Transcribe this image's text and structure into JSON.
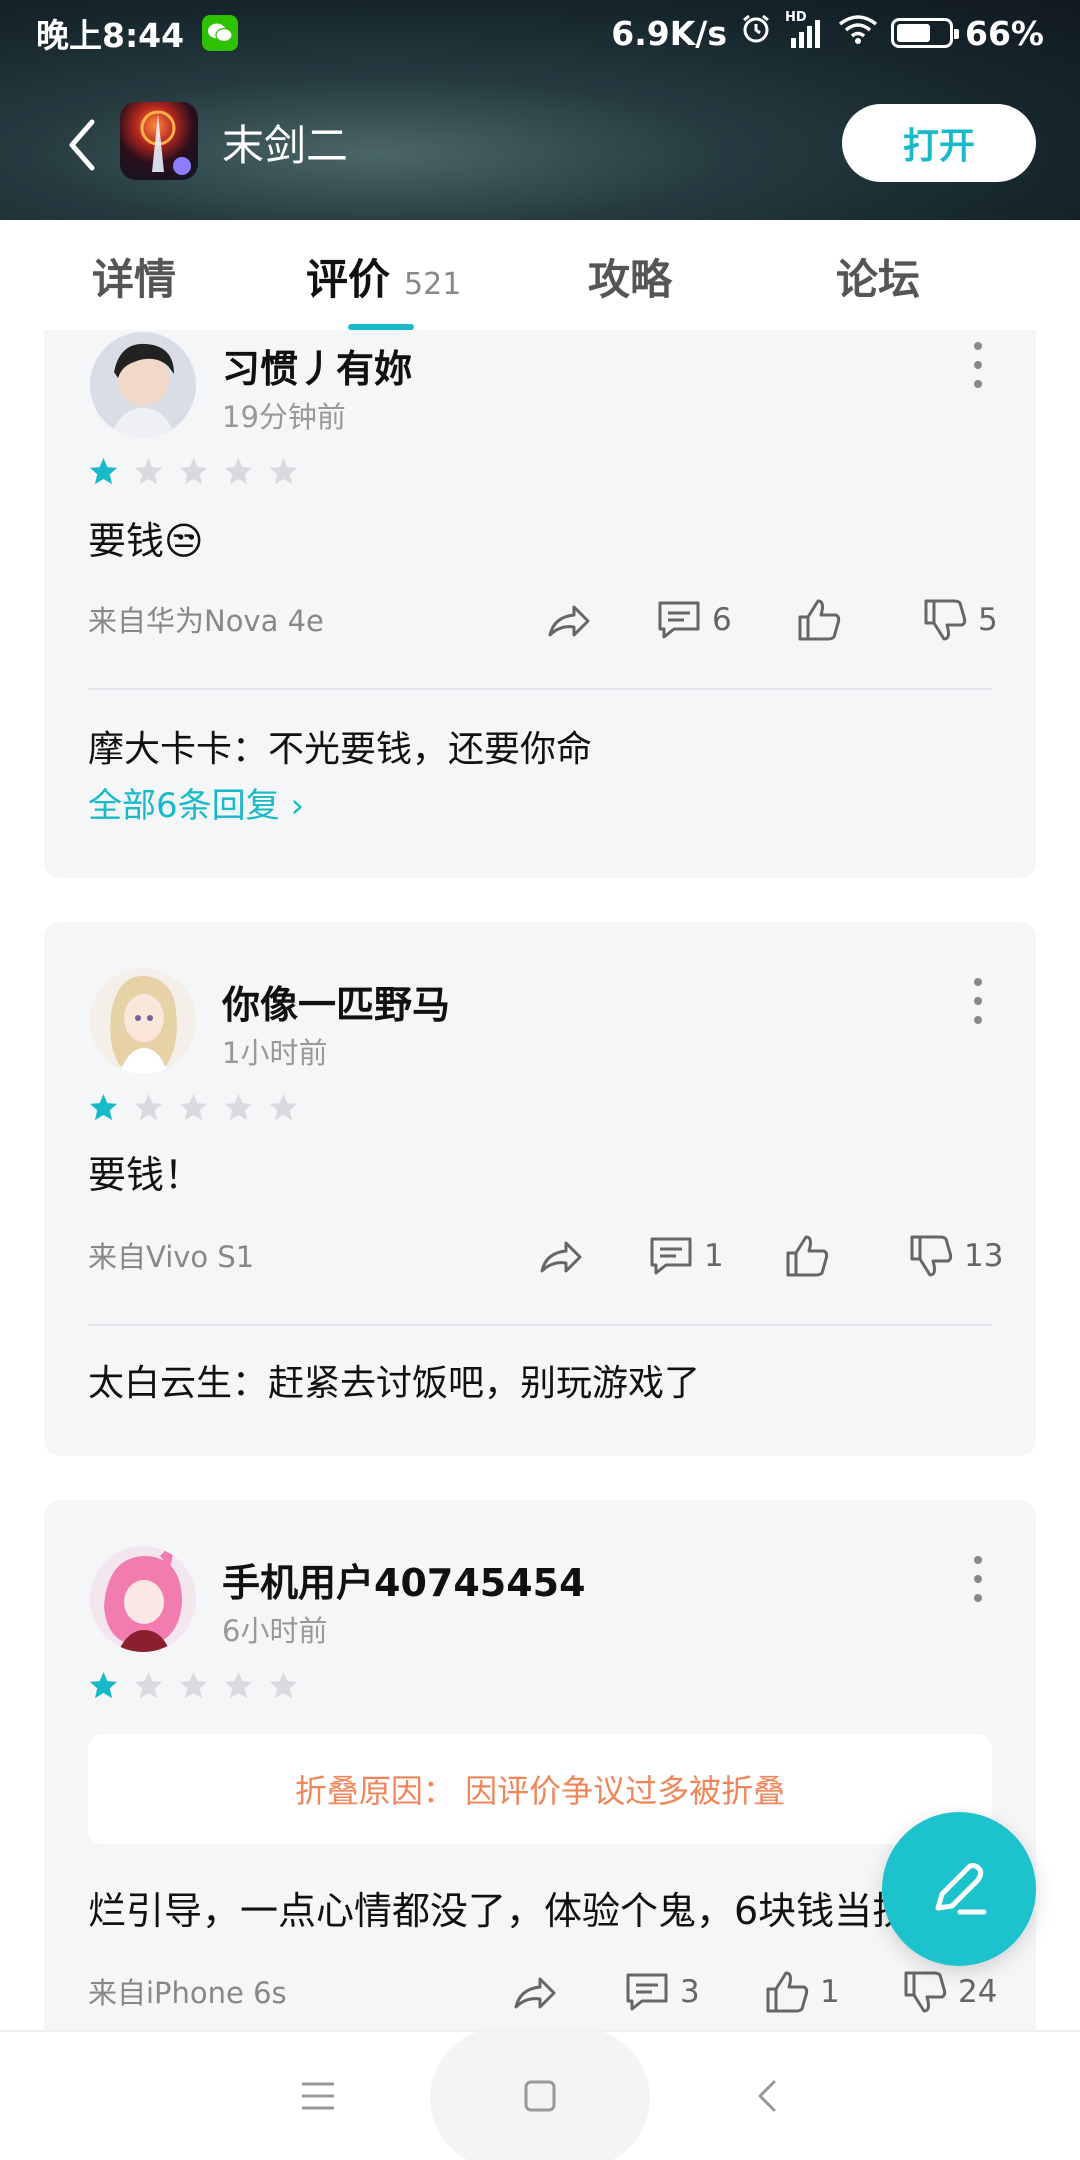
{
  "status_bar": {
    "time": "晚上8:44",
    "net_speed": "6.9K/s",
    "signal_label": "HD",
    "battery": "66%",
    "battery_level": 0.66
  },
  "header": {
    "app_title": "末剑二",
    "open_label": "打开"
  },
  "tabs": [
    {
      "label": "详情"
    },
    {
      "label": "评价",
      "count": "521"
    },
    {
      "label": "攻略"
    },
    {
      "label": "论坛"
    }
  ],
  "reviews": [
    {
      "username": "习惯丿有妳",
      "time": "19分钟前",
      "rating": 1,
      "text": "要钱😒",
      "device": "来自华为Nova 4e",
      "comments": "6",
      "likes": "",
      "dislikes": "5",
      "reply": "摩大卡卡：不光要钱，还要你命",
      "all_replies": "全部6条回复 ›"
    },
    {
      "username": "你像一匹野马",
      "time": "1小时前",
      "rating": 1,
      "text": "要钱！",
      "device": "来自Vivo S1",
      "comments": "1",
      "likes": "",
      "dislikes": "13",
      "reply": "太白云生：赶紧去讨饭吧，别玩游戏了"
    },
    {
      "username": "手机用户40745454",
      "time": "6小时前",
      "rating": 1,
      "fold_reason": "折叠原因：  因评价争议过多被折叠",
      "text": "烂引导，一点心情都没了，体验个鬼，6块钱当扶",
      "device": "来自iPhone 6s",
      "comments": "3",
      "likes": "1",
      "dislikes": "24"
    }
  ],
  "colors": {
    "accent": "#18b9c8",
    "star_active": "#18b9c8",
    "star_inactive": "#d8dadd",
    "fold_text": "#f0855a"
  }
}
